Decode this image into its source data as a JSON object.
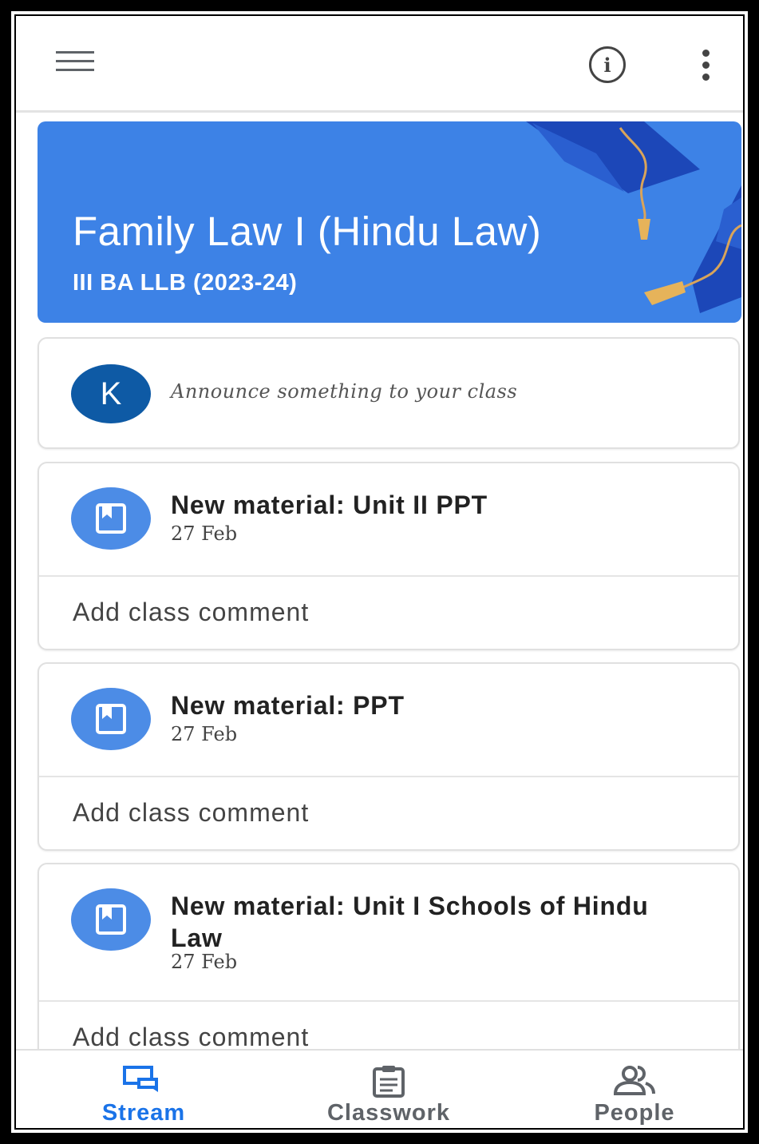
{
  "topbar": {
    "menu_icon": "hamburger-menu-icon",
    "info_icon": "info-icon",
    "info_glyph": "i",
    "more_icon": "more-vert-icon"
  },
  "class_banner": {
    "title": "Family Law I (Hindu Law)",
    "section": "III BA LLB (2023-24)",
    "color": "#3d82e6"
  },
  "announce": {
    "avatar_letter": "K",
    "avatar_color": "#0e5aa5",
    "placeholder": "Announce something to your class"
  },
  "posts": [
    {
      "title": "New material: Unit II PPT",
      "date": "27 Feb",
      "comment_label": "Add class comment",
      "icon": "material-icon"
    },
    {
      "title": "New material: PPT",
      "date": "27 Feb",
      "comment_label": "Add class comment",
      "icon": "material-icon"
    },
    {
      "title": "New material: Unit I Schools of Hindu Law",
      "date": "27 Feb",
      "comment_label": "Add class comment",
      "icon": "material-icon"
    }
  ],
  "bottom_nav": {
    "stream": {
      "label": "Stream",
      "icon": "stream-icon",
      "active": true
    },
    "classwork": {
      "label": "Classwork",
      "icon": "classwork-icon",
      "active": false
    },
    "people": {
      "label": "People",
      "icon": "people-icon",
      "active": false
    }
  },
  "colors": {
    "active_tab": "#1a73e8",
    "inactive_tab": "#5f6368",
    "post_icon_bg": "#4c8ce6"
  }
}
